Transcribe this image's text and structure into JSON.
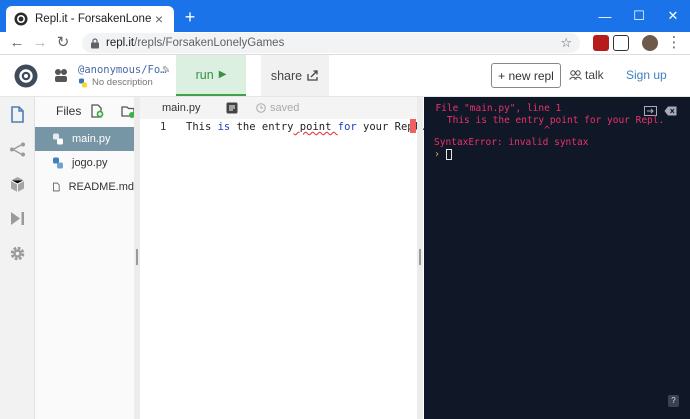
{
  "browser": {
    "tab_title": "Repl.it - ForsakenLonelyGames",
    "tab_close": "×",
    "new_tab": "+",
    "url_host": "repl.it",
    "url_path": "/repls/ForsakenLonelyGames",
    "star": "☆",
    "back": "←",
    "forward": "→",
    "reload": "↻",
    "menu": "⋮",
    "win_min": "—",
    "win_max": "☐",
    "win_close": "✕",
    "accent": "#1a73e8"
  },
  "header": {
    "owner": "@anonymous/Fo…",
    "description": "No description",
    "run_label": "run",
    "run_icon": "▶",
    "share_label": "share",
    "new_repl_label": "+ new repl",
    "talk_label": "talk",
    "signup_label": "Sign up",
    "run_color": "#3a9144"
  },
  "files": {
    "title": "Files",
    "items": [
      {
        "name": "main.py",
        "icon": "python-icon",
        "active": true
      },
      {
        "name": "jogo.py",
        "icon": "python-icon",
        "active": false
      },
      {
        "name": "README.md",
        "icon": "document-icon",
        "active": false
      }
    ]
  },
  "editor": {
    "file_name": "main.py",
    "saved_label": "saved",
    "lines": [
      {
        "num": "1",
        "seg_a": "This ",
        "kw_a": "is",
        "seg_b": " the entry",
        "seg_c": " point ",
        "kw_b": "for",
        "seg_d": " your ",
        "seg_e": "Repl."
      }
    ]
  },
  "console": {
    "lines": [
      "  File \"main.py\", line 1",
      "    This is the entry point for your Repl.",
      "                     ^",
      "SyntaxError: invalid syntax"
    ],
    "prompt": "›",
    "help": "?",
    "error_color": "#e8336a"
  }
}
